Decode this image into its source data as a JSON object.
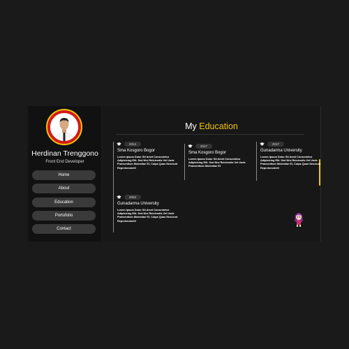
{
  "profile": {
    "name": "Herdinan Trenggono",
    "role": "Front End Developer"
  },
  "nav": [
    {
      "label": "Home"
    },
    {
      "label": "About"
    },
    {
      "label": "Education"
    },
    {
      "label": "Portofolio"
    },
    {
      "label": "Contact"
    }
  ],
  "section": {
    "title_prefix": "My",
    "title_accent": "Education"
  },
  "education": [
    {
      "year": "2014",
      "school": "Sma Kosgoro Bogor",
      "desc": "Lorem Ipsum Dolor Sit Amet Consectetur Adipisicing Elit. Sed Nisi Reiciendis Vel Unde Praesentium Molestiae Et, Culpa Quas Nesciunt Reprehenderit!"
    },
    {
      "year": "2017",
      "school": "Sma Kosgoro Bogor",
      "desc": "Lorem Ipsum Dolor Sit Amet Consectetur Adipisicing Elit. Sed Nisi Reiciendis Vel Unde Praesentium Molestiae Et"
    },
    {
      "year": "2017",
      "school": "Gunadarma University",
      "desc": "Lorem Ipsum Dolor Sit Amet Consectetur Adipisicing Elit. Sed Nisi Reiciendis Vel Unde Praesentium Molestiae Et, Culpa Quas Nesciunt Reprehenderit!"
    },
    {
      "year": "2022",
      "school": "Gunadarma University",
      "desc": "Lorem Ipsum Dolor Sit Amet Consectetur Adipisicing Elit. Sed Nisi Reiciendis Vel Unde Praesentium Molestiae Et, Culpa Quas Nesciunt Reprehenderit!"
    }
  ],
  "icons": {
    "education_item": "graduation-cap-icon",
    "mascot": "anime-mascot-icon"
  },
  "colors": {
    "accent": "#f2c20a",
    "avatar_ring": "#d11a1a",
    "background": "#1a1a1a",
    "panel": "#171717",
    "button": "#3a3a3a"
  }
}
